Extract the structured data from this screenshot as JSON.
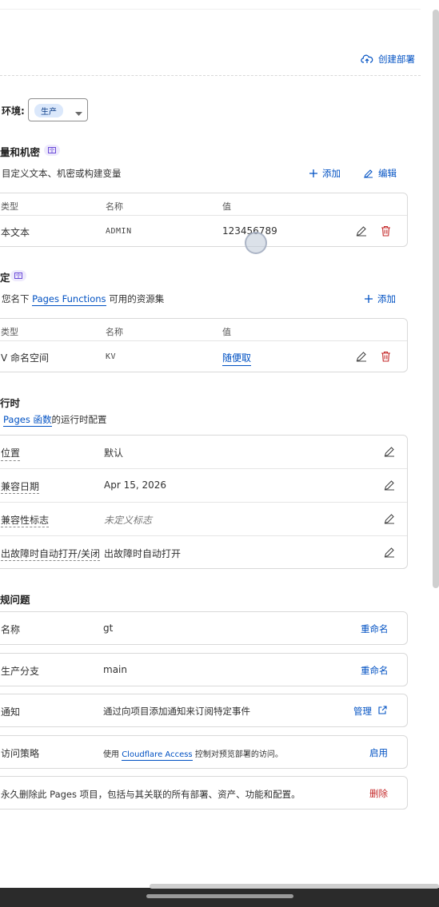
{
  "top_actions": {
    "create_deployment": "创建部署"
  },
  "environment": {
    "label": "环境:",
    "selected": "生产"
  },
  "variables": {
    "title": "量和机密",
    "description": "目定义文本、机密或构建变量",
    "add_label": "添加",
    "edit_label": "编辑",
    "columns": [
      "类型",
      "名称",
      "值"
    ],
    "rows": [
      {
        "type": "本文本",
        "name": "ADMIN",
        "value": "123456789"
      }
    ]
  },
  "bindings": {
    "title": "定",
    "description_prefix": "您名下",
    "description_link": "Pages Functions",
    "description_suffix": "可用的资源集",
    "add_label": "添加",
    "columns": [
      "类型",
      "名称",
      "值"
    ],
    "rows": [
      {
        "type": "V 命名空间",
        "name": "KV",
        "value": "随便取"
      }
    ]
  },
  "runtime": {
    "title": "行时",
    "description_link": "Pages 函数",
    "description_suffix": "的运行时配置",
    "rows": [
      {
        "label": "位置",
        "value": "默认"
      },
      {
        "label": "兼容日期",
        "value": "Apr 15, 2026"
      },
      {
        "label": "兼容性标志",
        "value": "未定义标志"
      },
      {
        "label": "出故障时自动打开/关闭",
        "value": "出故障时自动打开"
      }
    ]
  },
  "general": {
    "title": "规问题",
    "project_name": {
      "label": "名称",
      "value": "gt",
      "action": "重命名"
    },
    "production_branch": {
      "label": "生产分支",
      "value": "main",
      "action": "重命名"
    },
    "notifications": {
      "label": "通知",
      "value": "通过向项目添加通知来订阅特定事件",
      "action": "管理"
    },
    "access_policy": {
      "label": "访问策略",
      "value_prefix": "使用",
      "value_link": "Cloudflare Access",
      "value_suffix": "控制对预览部署的访问。",
      "action": "启用"
    },
    "delete": {
      "text": "永久删除此 Pages 项目，包括与其关联的所有部署、资产、功能和配置。",
      "action": "删除"
    }
  },
  "colors": {
    "accent": "#0051c3",
    "danger": "#c42829",
    "badge_bg": "#dbe8fb"
  }
}
